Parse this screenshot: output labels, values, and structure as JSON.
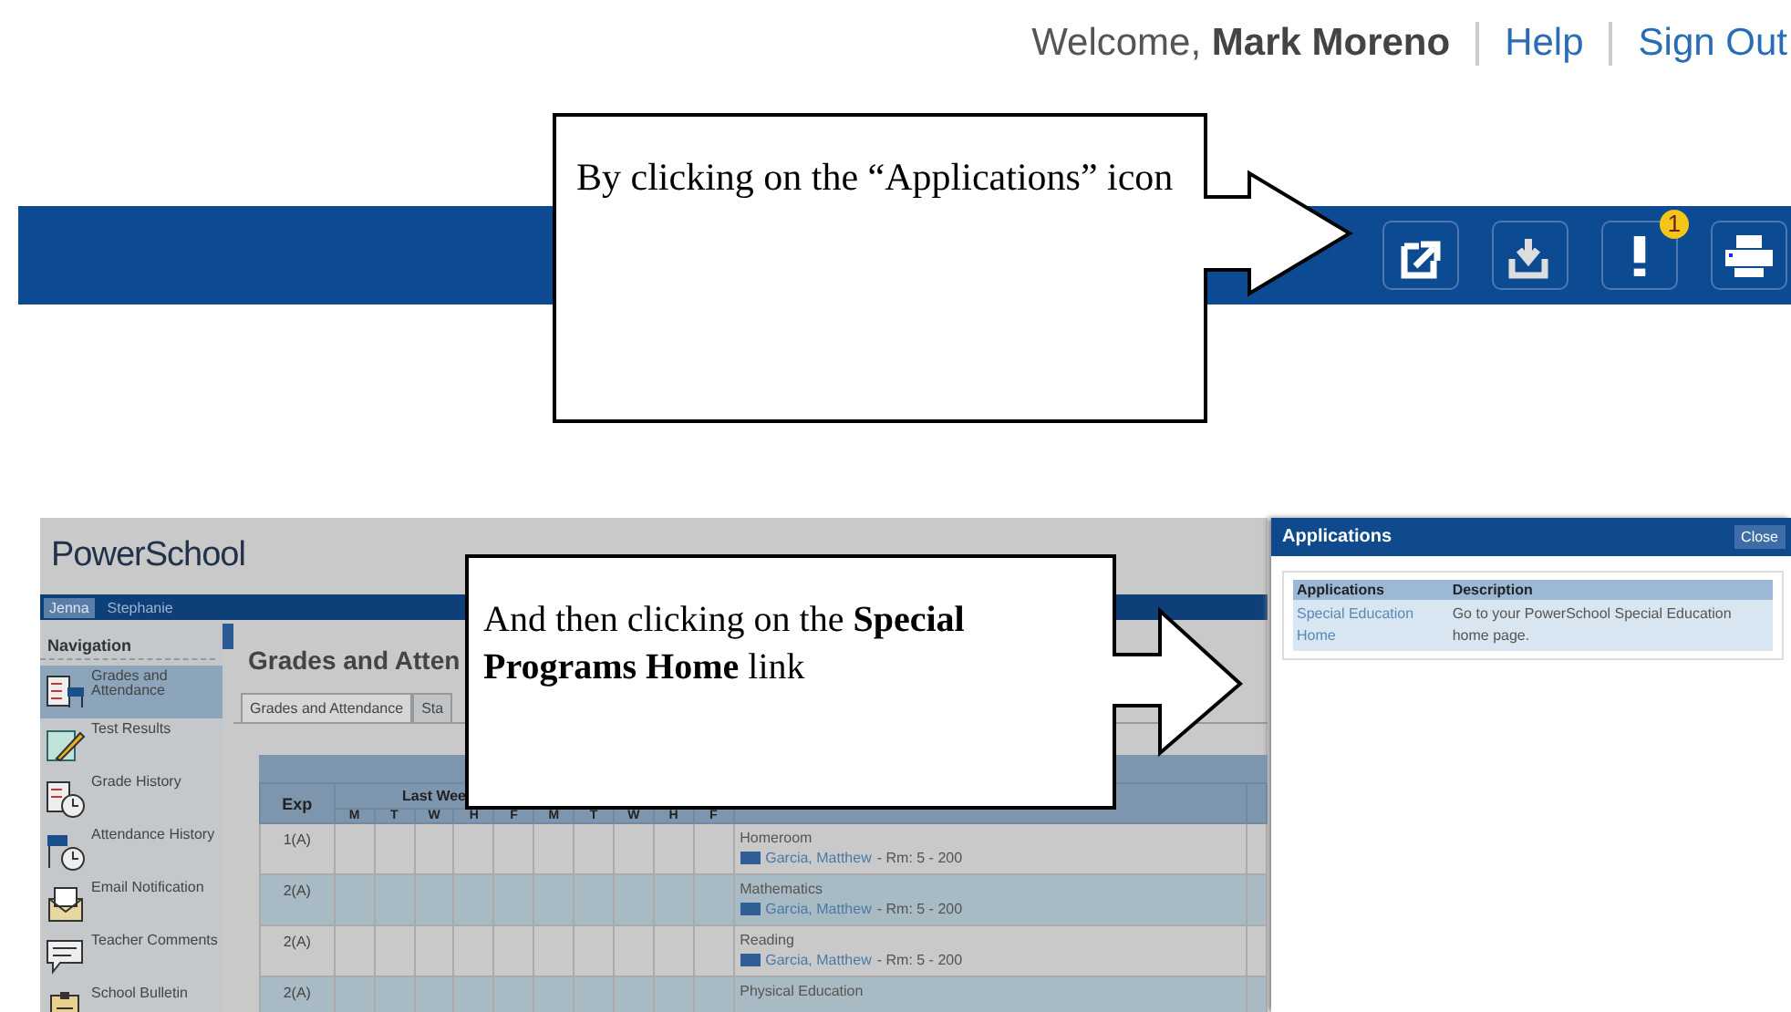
{
  "header": {
    "welcome": "Welcome, **Mark Moreno**",
    "links": [
      "Help",
      "Sign Out"
    ]
  },
  "toolbar": {
    "alert_badge": "1"
  },
  "callouts": [
    {
      "text": "By clicking on the “Applications” icon"
    },
    {
      "text": "And then clicking on the **Special Programs Home** link"
    }
  ],
  "app": {
    "logo": "PowerSchool",
    "students": [
      {
        "name": "Jenna",
        "selected": true
      },
      {
        "name": "Stephanie",
        "selected": false
      }
    ],
    "navigation": {
      "title": "Navigation",
      "items": [
        {
          "label": "Grades and Attendance",
          "selected": true
        },
        {
          "label": "Test Results",
          "selected": false
        },
        {
          "label": "Grade History",
          "selected": false
        },
        {
          "label": "Attendance History",
          "selected": false
        },
        {
          "label": "Email Notification",
          "selected": false
        },
        {
          "label": "Teacher Comments",
          "selected": false
        },
        {
          "label": "School Bulletin",
          "selected": false
        }
      ]
    },
    "page_title": "Grades and Atten",
    "tabs": [
      {
        "label": "Grades and Attendance",
        "selected": true
      },
      {
        "label": "Sta",
        "selected": false
      }
    ],
    "table": {
      "exp_header": "Exp",
      "week_header": "Last Wee",
      "days": [
        "M",
        "T",
        "W",
        "H",
        "F",
        "M",
        "T",
        "W",
        "H",
        "F"
      ],
      "rows": [
        {
          "exp": "1(A)",
          "course": "Homeroom",
          "teacher": "Garcia, Matthew",
          "room": "- Rm: 5 - 200"
        },
        {
          "exp": "2(A)",
          "course": "Mathematics",
          "teacher": "Garcia, Matthew",
          "room": "- Rm: 5 - 200"
        },
        {
          "exp": "2(A)",
          "course": "Reading",
          "teacher": "Garcia, Matthew",
          "room": "- Rm: 5 - 200"
        },
        {
          "exp": "2(A)",
          "course": "Physical Education"
        }
      ]
    }
  },
  "applications_panel": {
    "title": "Applications",
    "close": "Close",
    "columns": [
      "Applications",
      "Description"
    ],
    "rows": [
      {
        "application": "Special Education Home",
        "description": "Go to your PowerSchool Special Education home page."
      }
    ]
  }
}
